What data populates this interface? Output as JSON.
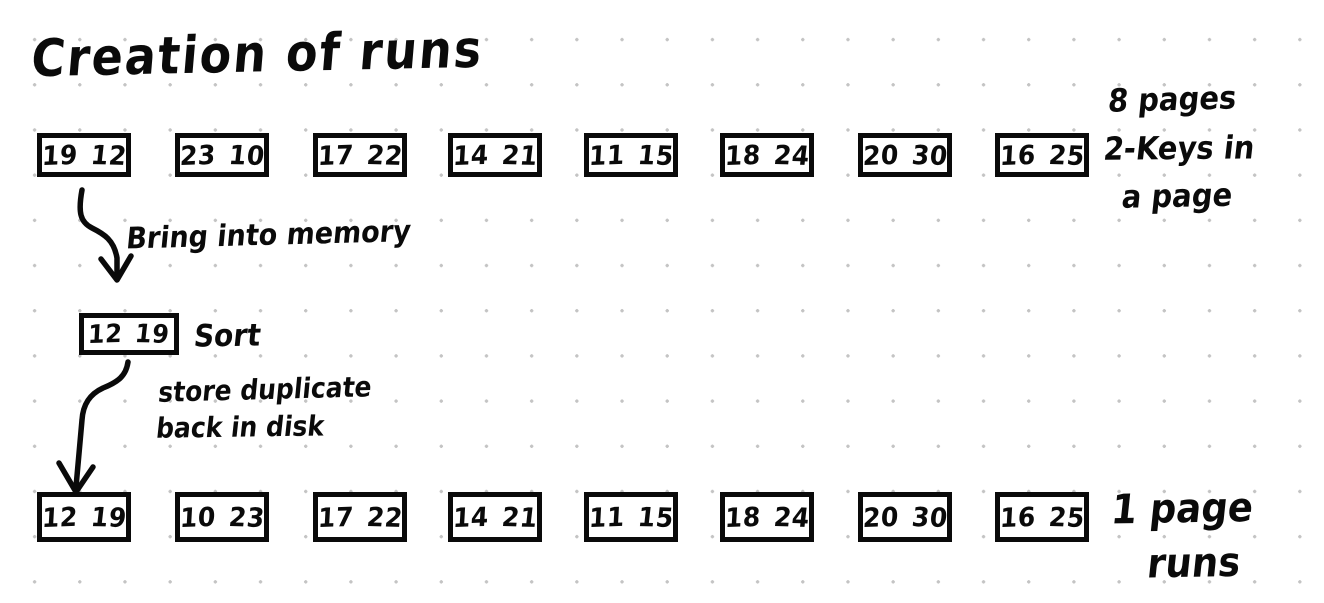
{
  "title": "Creation of runs",
  "background": {
    "color": "#ffffff",
    "grid_dot_color": "#c4c4c4",
    "ink_color": "#0a0a0a"
  },
  "top_row": {
    "label": "disk-pages-before-sort",
    "pages": [
      {
        "keys": [
          "19",
          "12"
        ]
      },
      {
        "keys": [
          "23",
          "10"
        ]
      },
      {
        "keys": [
          "17",
          "22"
        ]
      },
      {
        "keys": [
          "14",
          "21"
        ]
      },
      {
        "keys": [
          "11",
          "15"
        ]
      },
      {
        "keys": [
          "18",
          "24"
        ]
      },
      {
        "keys": [
          "20",
          "30"
        ]
      },
      {
        "keys": [
          "16",
          "25"
        ]
      }
    ]
  },
  "memory_page": {
    "keys": [
      "12",
      "19"
    ]
  },
  "bottom_row": {
    "label": "disk-pages-after-sort",
    "pages": [
      {
        "keys": [
          "12",
          "19"
        ]
      },
      {
        "keys": [
          "10",
          "23"
        ]
      },
      {
        "keys": [
          "17",
          "22"
        ]
      },
      {
        "keys": [
          "14",
          "21"
        ]
      },
      {
        "keys": [
          "11",
          "15"
        ]
      },
      {
        "keys": [
          "18",
          "24"
        ]
      },
      {
        "keys": [
          "20",
          "30"
        ]
      },
      {
        "keys": [
          "16",
          "25"
        ]
      }
    ]
  },
  "annotations": {
    "bring_into_memory": "Bring into memory",
    "sort": "Sort",
    "store_duplicate": "store duplicate",
    "back_in_disk": "back in disk",
    "pages_count": "8 pages",
    "keys_in": "2-Keys in",
    "a_page": "a page",
    "one_page": "1 page",
    "runs": "runs"
  }
}
